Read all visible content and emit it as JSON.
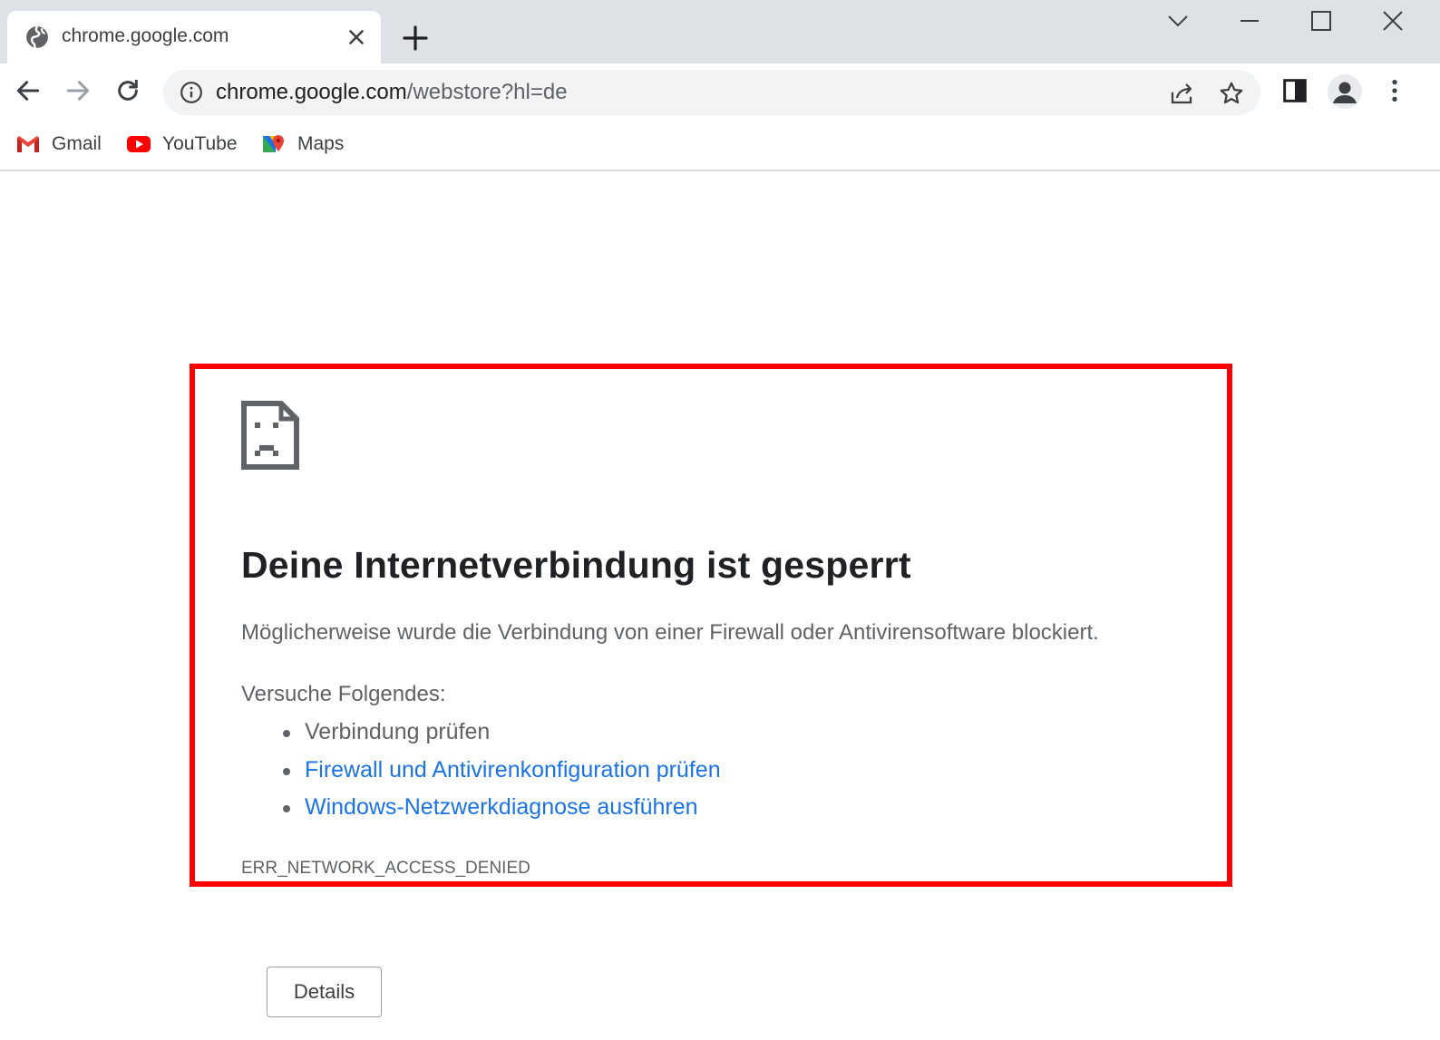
{
  "tab": {
    "title": "chrome.google.com",
    "close_icon": "close-icon",
    "favicon": "globe-icon"
  },
  "window_controls": [
    "chevron-down-icon",
    "minimize-icon",
    "maximize-icon",
    "close-icon"
  ],
  "toolbar": {
    "url_host": "chrome.google.com",
    "url_path": "/webstore?hl=de",
    "icons": [
      "back-icon",
      "forward-icon",
      "reload-icon",
      "info-icon",
      "share-icon",
      "star-icon",
      "side-panel-icon",
      "avatar-icon",
      "kebab-menu-icon"
    ]
  },
  "bookmarks": [
    {
      "label": "Gmail",
      "icon": "gmail-icon"
    },
    {
      "label": "YouTube",
      "icon": "youtube-icon"
    },
    {
      "label": "Maps",
      "icon": "maps-icon"
    }
  ],
  "error": {
    "title": "Deine Internetverbindung ist gesperrt",
    "description": "Möglicherweise wurde die Verbindung von einer Firewall oder Antivirensoftware blockiert.",
    "try_heading": "Versuche Folgendes:",
    "suggestions": [
      {
        "text": "Verbindung prüfen",
        "link": false
      },
      {
        "text": "Firewall und Antivirenkonfiguration prüfen",
        "link": true
      },
      {
        "text": "Windows-Netzwerkdiagnose ausführen",
        "link": true
      }
    ],
    "code": "ERR_NETWORK_ACCESS_DENIED",
    "details_button": "Details"
  },
  "colors": {
    "highlight": "#ff0000",
    "link": "#1a73e8",
    "tabstrip": "#dee1e6",
    "omnibox": "#f1f3f4"
  }
}
